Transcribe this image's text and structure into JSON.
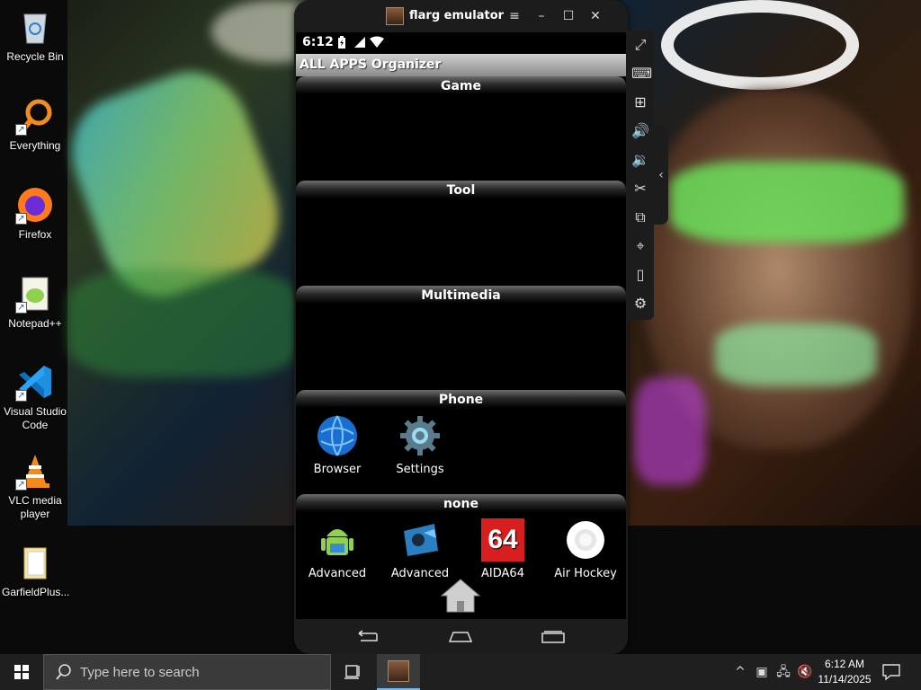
{
  "desktop": {
    "icons": [
      {
        "label": "Recycle Bin"
      },
      {
        "label": "Everything"
      },
      {
        "label": "Firefox"
      },
      {
        "label": "Notepad++"
      },
      {
        "label": "Visual Studio Code"
      },
      {
        "label": "VLC media player"
      },
      {
        "label": "GarfieldPlus..."
      }
    ]
  },
  "emulator": {
    "title": "flarg emulator",
    "status": {
      "time": "6:12"
    },
    "app_title": "ALL APPS Organizer",
    "sections": [
      {
        "name": "Game",
        "apps": []
      },
      {
        "name": "Tool",
        "apps": []
      },
      {
        "name": "Multimedia",
        "apps": []
      },
      {
        "name": "Phone",
        "apps": [
          {
            "label": "Browser",
            "icon": "globe-icon"
          },
          {
            "label": "Settings",
            "icon": "gear-icon"
          }
        ]
      },
      {
        "name": "none",
        "apps": [
          {
            "label": "Advanced",
            "icon": "android-icon"
          },
          {
            "label": "Advanced",
            "icon": "gamepad-icon"
          },
          {
            "label": "AIDA64",
            "icon": "aida64-icon",
            "badge": "64"
          },
          {
            "label": "Air Hockey",
            "icon": "puck-icon"
          }
        ]
      }
    ]
  },
  "taskbar": {
    "search_placeholder": "Type here to search",
    "clock_time": "6:12 AM",
    "clock_date": "11/14/2025"
  },
  "colors": {
    "accent": "#76b9ed",
    "taskbar": "#1f1f1f",
    "emulator_chrome": "#1c1c1c",
    "aida_red": "#d81e1e"
  }
}
